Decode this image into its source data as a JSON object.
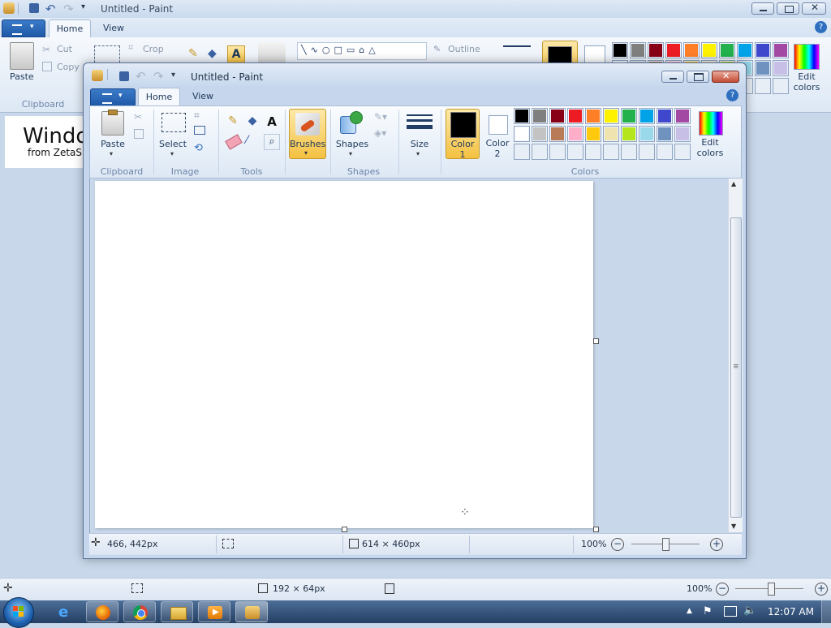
{
  "background_window": {
    "title": "Untitled - Paint",
    "tabs": [
      {
        "label": "Home",
        "active": true
      },
      {
        "label": "View",
        "active": false
      }
    ],
    "image_group": {
      "crop_label": "Crop"
    },
    "clipboard_group": {
      "paste_label": "Paste",
      "cut_label": "Cut",
      "copy_label": "Copy",
      "group_label": "Clipboard"
    },
    "shapes_group": {
      "outline_label": "Outline"
    },
    "edit_colors_label": "Edit colors",
    "status": {
      "selection_size": "192 × 64px",
      "zoom": "100%"
    },
    "desktop_text": {
      "line1": "Windo",
      "line2": "from ZetaS"
    }
  },
  "foreground_window": {
    "title": "Untitled - Paint",
    "tabs": [
      {
        "label": "Home",
        "active": true
      },
      {
        "label": "View",
        "active": false
      }
    ],
    "clipboard": {
      "paste_label": "Paste",
      "group_label": "Clipboard"
    },
    "image": {
      "select_label": "Select",
      "group_label": "Image"
    },
    "tools": {
      "group_label": "Tools"
    },
    "brushes": {
      "label": "Brushes",
      "selected": true
    },
    "shapes": {
      "label": "Shapes",
      "group_label": "Shapes"
    },
    "size": {
      "label": "Size"
    },
    "color1": {
      "label_line1": "Color",
      "label_line2": "1",
      "value": "#000000"
    },
    "color2": {
      "label_line1": "Color",
      "label_line2": "2",
      "value": "#ffffff"
    },
    "colors_group_label": "Colors",
    "edit_colors": {
      "line1": "Edit",
      "line2": "colors"
    },
    "palette_row1": [
      "#000000",
      "#7f7f7f",
      "#880015",
      "#ed1c24",
      "#ff7f27",
      "#fff200",
      "#22b14c",
      "#00a2e8",
      "#3f48cc",
      "#a349a4"
    ],
    "palette_row2": [
      "#ffffff",
      "#c3c3c3",
      "#b97a57",
      "#ffaec9",
      "#ffc90e",
      "#efe4b0",
      "#b5e61d",
      "#99d9ea",
      "#7092be",
      "#c8bfe7"
    ],
    "status": {
      "cursor_position": "466, 442px",
      "canvas_size": "614 × 460px",
      "zoom": "100%"
    }
  },
  "taskbar": {
    "clock": "12:07 AM",
    "apps": [
      "start-orb",
      "internet-explorer",
      "firefox",
      "chrome",
      "windows-explorer",
      "media-player",
      "paint"
    ]
  }
}
